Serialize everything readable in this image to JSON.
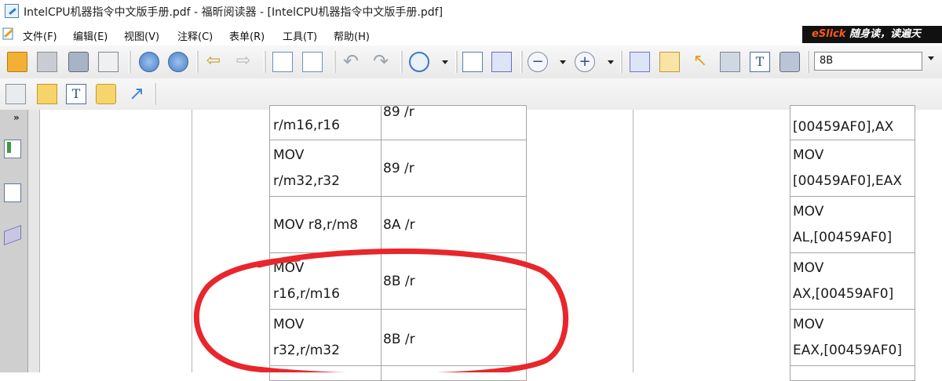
{
  "window": {
    "title": "IntelCPU机器指令中文版手册.pdf - 福昕阅读器 - [IntelCPU机器指令中文版手册.pdf]"
  },
  "menu": {
    "items": [
      "文件(F)",
      "编辑(E)",
      "视图(V)",
      "注释(C)",
      "表单(R)",
      "工具(T)",
      "帮助(H)"
    ],
    "ad": {
      "brand": "eSlick",
      "text": " 随身读，读遍天"
    }
  },
  "toolbar": {
    "zoom_value": "8B"
  },
  "table": {
    "rows": [
      {
        "instruction": [
          "r/m16,r16"
        ],
        "opcode": "89 /r",
        "example": [
          "[00459AF0],AX"
        ]
      },
      {
        "instruction": [
          "MOV",
          "r/m32,r32"
        ],
        "opcode": "89 /r",
        "example": [
          "MOV",
          "[00459AF0],EAX"
        ]
      },
      {
        "instruction": [
          "MOV r8,r/m8"
        ],
        "opcode": "8A /r",
        "example": [
          "MOV",
          "AL,[00459AF0]"
        ]
      },
      {
        "instruction": [
          "MOV",
          "r16,r/m16"
        ],
        "opcode": "8B /r",
        "example": [
          "MOV",
          "AX,[00459AF0]"
        ]
      },
      {
        "instruction": [
          "MOV",
          "r32,r/m32"
        ],
        "opcode": "8B /r",
        "example": [
          "MOV",
          "EAX,[00459AF0]"
        ]
      }
    ]
  },
  "annotation": {
    "color": "#e8262b"
  }
}
